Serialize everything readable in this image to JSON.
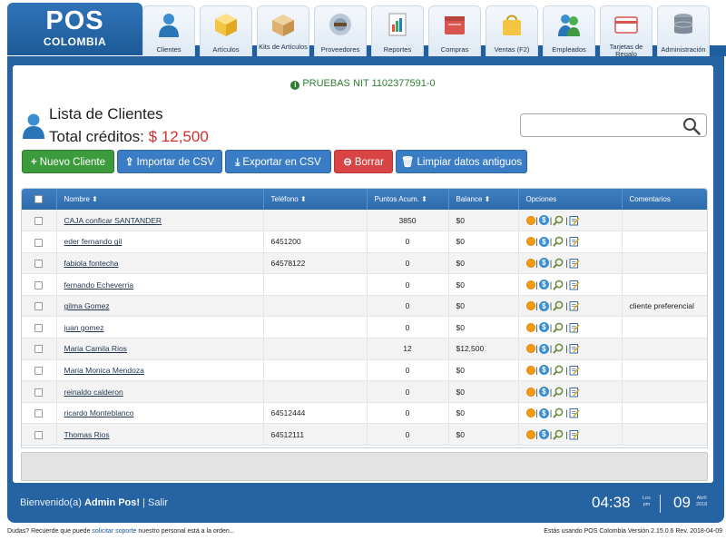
{
  "header": {
    "logo_main": "POS",
    "logo_sub": "COLOMBIA",
    "nav": [
      {
        "label": "Clientes",
        "icon": "person-icon"
      },
      {
        "label": "Artículos",
        "icon": "box-icon"
      },
      {
        "label": "Kits de Artículos",
        "icon": "kit-box-icon"
      },
      {
        "label": "Proveedores",
        "icon": "suppliers-icon"
      },
      {
        "label": "Reportes",
        "icon": "report-icon"
      },
      {
        "label": "Compras",
        "icon": "purchases-icon"
      },
      {
        "label": "Ventas (F2)",
        "icon": "shopping-bag-icon"
      },
      {
        "label": "Empleados",
        "icon": "employees-icon"
      },
      {
        "label": "Tarjetas de Regalo",
        "icon": "gift-card-icon"
      },
      {
        "label": "Administración",
        "icon": "database-icon"
      }
    ]
  },
  "notice": "PRUEBAS NIT 1102377591-0",
  "page": {
    "title": "Lista de Clientes",
    "credits_label": "Total créditos:",
    "credits_value": "$ 12,500",
    "search_value": ""
  },
  "actions": {
    "new": "Nuevo Cliente",
    "import": "Importar de CSV",
    "export": "Exportar en CSV",
    "delete": "Borrar",
    "clean": "Limpiar datos antiguos"
  },
  "table": {
    "headers": {
      "name": "Nombre ⬍",
      "phone": "Teléfono ⬍",
      "points": "Puntos Acum. ⬍",
      "balance": "Balance ⬍",
      "options": "Opciones",
      "comments": "Comentarios"
    },
    "rows": [
      {
        "name": "CAJA conficar SANTANDER",
        "phone": "",
        "points": "3850",
        "balance": "$0",
        "comment": ""
      },
      {
        "name": "eder fernando gil",
        "phone": "6451200",
        "points": "0",
        "balance": "$0",
        "comment": ""
      },
      {
        "name": "fabiola fontecha",
        "phone": "64578122",
        "points": "0",
        "balance": "$0",
        "comment": ""
      },
      {
        "name": "fernando Echeverria",
        "phone": "",
        "points": "0",
        "balance": "$0",
        "comment": ""
      },
      {
        "name": "gilma Gomez",
        "phone": "",
        "points": "0",
        "balance": "$0",
        "comment": "cliente preferencial"
      },
      {
        "name": "juan gomez",
        "phone": "",
        "points": "0",
        "balance": "$0",
        "comment": ""
      },
      {
        "name": "Maria Camila Rios",
        "phone": "",
        "points": "12",
        "balance": "$12,500",
        "comment": ""
      },
      {
        "name": "Maria Monica Mendoza",
        "phone": "",
        "points": "0",
        "balance": "$0",
        "comment": ""
      },
      {
        "name": "reinaldo calderon",
        "phone": "",
        "points": "0",
        "balance": "$0",
        "comment": ""
      },
      {
        "name": "ricardo Monteblanco",
        "phone": "64512444",
        "points": "0",
        "balance": "$0",
        "comment": ""
      },
      {
        "name": "Thomas Rios",
        "phone": "64512111",
        "points": "0",
        "balance": "$0",
        "comment": ""
      }
    ]
  },
  "status": {
    "welcome_prefix": "Bienvenido(a)",
    "user": "Admin Pos!",
    "separator": "|",
    "logout": "Salir",
    "time": "04:38",
    "ampm_top": "Los",
    "ampm_bottom": "pm",
    "day": "09",
    "month": "Abril",
    "year": "2018"
  },
  "footer": {
    "left_prefix": "Dudas? Recuerde que puede",
    "support_link": "solicitar soporte",
    "left_suffix": "nuestro personal está a la orden...",
    "right": "Estás usando POS Colombia Versión 2.15.0.6 Rev. 2018-04-09"
  },
  "colors": {
    "brand_blue": "#2563a3",
    "success_green": "#3c9b3c",
    "danger_red": "#d94545",
    "credit_red": "#d32f2f",
    "notice_green": "#2e7d32"
  }
}
